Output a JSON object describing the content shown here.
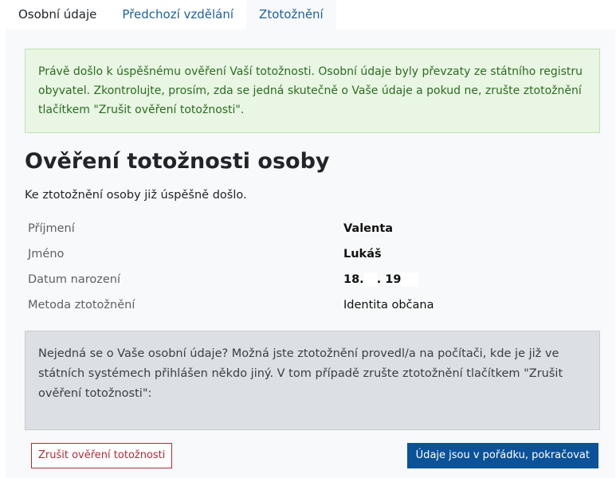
{
  "tabs": [
    {
      "label": "Osobní údaje",
      "active": false
    },
    {
      "label": "Předchozí vzdělání",
      "active": false
    },
    {
      "label": "Ztotožnění",
      "active": true
    }
  ],
  "success_alert": {
    "text": "Právě došlo k úspěšnému ověření Vaší totožnosti. Osobní údaje byly převzaty ze státního registru obyvatel. Zkontrolujte, prosím, zda se jedná skutečně o Vaše údaje a pokud ne, zrušte ztotožnění tlačítkem \"Zrušit ověření totožnosti\"."
  },
  "title": "Ověření totožnosti osoby",
  "subtitle": "Ke ztotožnění osoby již úspěšně došlo.",
  "details": [
    {
      "label": "Příjmení",
      "value": "Valenta"
    },
    {
      "label": "Jméno",
      "value": "Lukáš"
    },
    {
      "label": "Datum narození",
      "value_parts": [
        "18.",
        ". 19"
      ]
    },
    {
      "label": "Metoda ztotožnění",
      "value": "Identita občana"
    }
  ],
  "info_alert": {
    "text": "Nejedná se o Vaše osobní údaje? Možná jste ztotožnění provedl/a na počítači, kde je již ve státních systémech přihlášen někdo jiný. V tom případě zrušte ztotožnění tlačítkem \"Zrušit ověření totožnosti\":"
  },
  "buttons": {
    "cancel_label": "Zrušit ověření totožnosti",
    "confirm_label": "Údaje jsou v pořádku, pokračovat"
  },
  "colors": {
    "primary": "#0b5299",
    "danger": "#b02a37",
    "success_bg": "#e8f6e3",
    "info_bg": "#dcdfe3"
  }
}
